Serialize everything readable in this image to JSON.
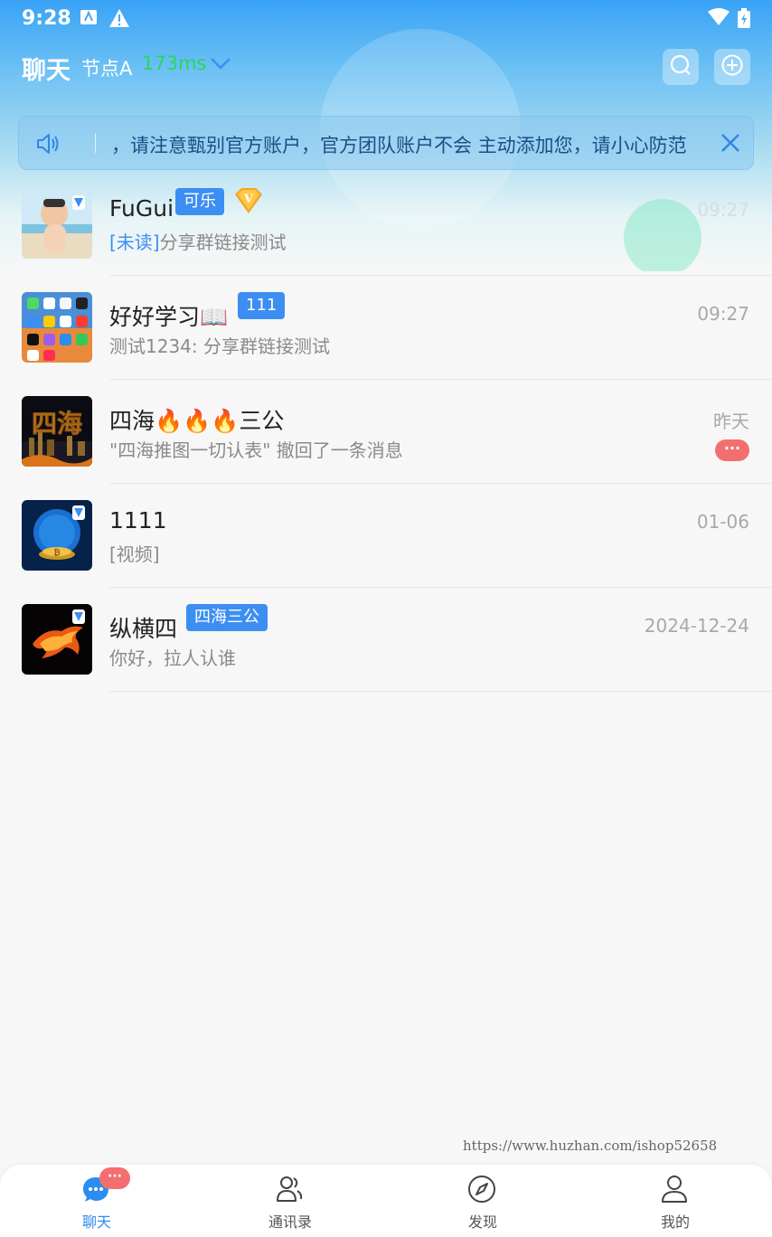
{
  "status_bar": {
    "time": "9:28"
  },
  "header": {
    "title": "聊天",
    "node": "节点A",
    "latency": "173ms"
  },
  "notice": {
    "text": "，请注意甄别官方账户，官方团队账户不会 主动添加您，请小心防范"
  },
  "chats": [
    {
      "name": "FuGui",
      "tag": "可乐",
      "vip": "V",
      "unread_label": "[未读]",
      "preview": "分享群链接测试",
      "time": "09:27"
    },
    {
      "name": "好好学习📖",
      "tag": "111",
      "preview": "测试1234: 分享群链接测试",
      "time": "09:27"
    },
    {
      "name": "四海🔥🔥🔥三公",
      "preview": "\"四海推图一切认表\" 撤回了一条消息",
      "time": "昨天",
      "badge": "···"
    },
    {
      "name": "1111",
      "preview": "[视频]",
      "time": "01-06"
    },
    {
      "name": "纵横四",
      "tag": "四海三公",
      "preview": "你好，拉人认谁",
      "time": "2024-12-24"
    }
  ],
  "avatar_texts": {
    "sihai": "四海"
  },
  "watermark": "https://www.huzhan.com/ishop52658",
  "tabs": [
    {
      "label": "聊天",
      "badge": "···",
      "active": true
    },
    {
      "label": "通讯录"
    },
    {
      "label": "发现"
    },
    {
      "label": "我的"
    }
  ],
  "colors": {
    "accent": "#2d8cf0",
    "tag": "#3c8ef2",
    "badge": "#f36f6f",
    "latency": "#27d85a"
  }
}
